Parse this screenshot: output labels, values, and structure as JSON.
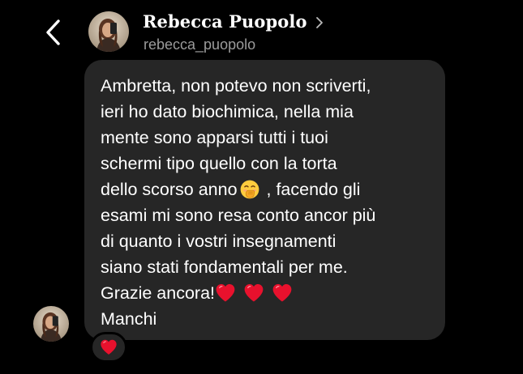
{
  "header": {
    "display_name": "Rebecca Puopolo",
    "username": "rebecca_puopolo",
    "back_icon": "chevron-left-icon",
    "name_chevron_icon": "chevron-right-icon"
  },
  "message": {
    "lines": [
      [
        "Ambretta, non potevo non scriverti,"
      ],
      [
        "ieri ho dato biochimica, nella mia"
      ],
      [
        "mente sono apparsi tutti i tuoi"
      ],
      [
        "schermi tipo quello con la torta"
      ],
      [
        "dello scorso anno",
        "face-with-hand-over-mouth-emoji",
        " , facendo gli"
      ],
      [
        "esami mi sono resa conto ancor più"
      ],
      [
        "di quanto i vostri insegnamenti"
      ],
      [
        "siano stati fondamentali per me."
      ],
      [
        "Grazie ancora!",
        "red-heart-emoji",
        "red-heart-emoji",
        "red-heart-emoji"
      ],
      [
        "Manchi"
      ]
    ]
  },
  "reaction": {
    "emoji": "red-heart-emoji"
  },
  "colors": {
    "background": "#000000",
    "bubble": "#262626",
    "text": "#ffffff",
    "username": "#9b9b9b",
    "heart": "#e8112d",
    "emoji_face": "#ffcc3e"
  }
}
